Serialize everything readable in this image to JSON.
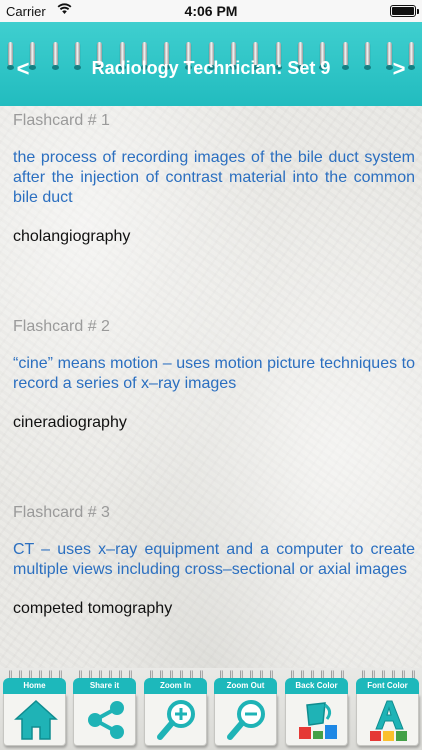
{
  "status_bar": {
    "carrier": "Carrier",
    "time": "4:06 PM"
  },
  "header": {
    "title": "Radiology Technician: Set 9",
    "prev_label": "<",
    "next_label": ">"
  },
  "cards": [
    {
      "label": "Flashcard # 1",
      "question": "the process of recording images of the bile duct system after the injection of contrast material into the common bile duct",
      "answer": "cholangiography"
    },
    {
      "label": "Flashcard # 2",
      "question": "“cine” means motion – uses motion picture techniques to record a series of x–ray images",
      "answer": "cineradiography"
    },
    {
      "label": "Flashcard # 3",
      "question": "CT – uses x–ray equipment and a computer to create multiple views including cross–sectional or axial images",
      "answer": "competed tomography"
    }
  ],
  "toolbar": {
    "home": "Home",
    "share": "Share it",
    "zoom_in": "Zoom In",
    "zoom_out": "Zoom Out",
    "back_color": "Back Color",
    "font_color": "Font Color"
  },
  "colors": {
    "accent": "#22bcbf",
    "question_text": "#2b6fc0",
    "label_text": "#9a9a9a"
  }
}
